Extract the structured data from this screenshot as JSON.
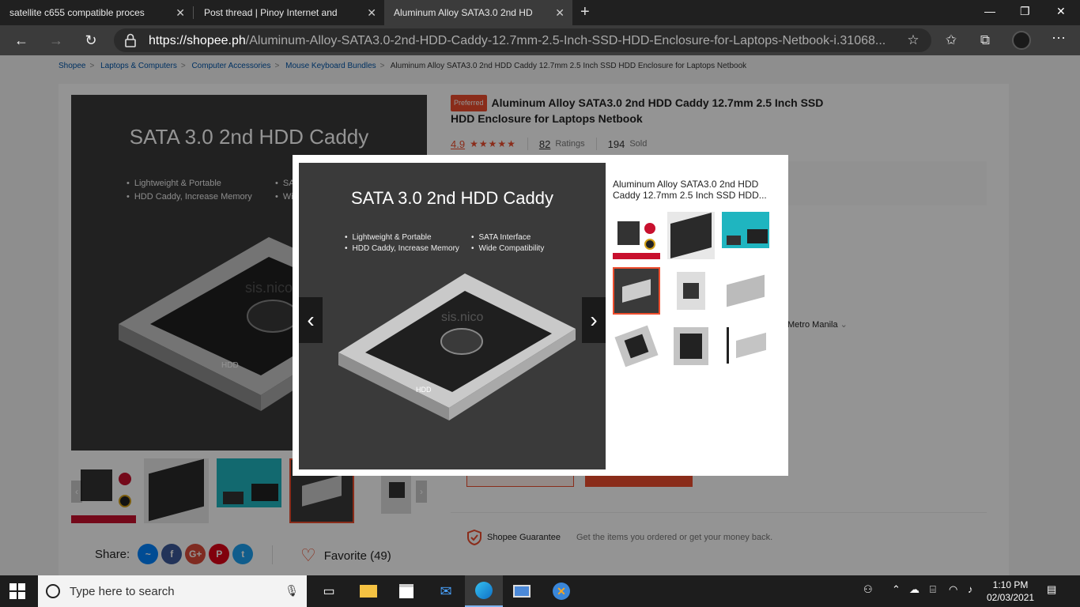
{
  "browser": {
    "tabs": [
      {
        "title": "satellite c655 compatible proces",
        "active": false
      },
      {
        "title": "Post thread | Pinoy Internet and",
        "active": false
      },
      {
        "title": "Aluminum Alloy SATA3.0 2nd HD",
        "active": true
      }
    ],
    "url_host": "https://shopee.ph",
    "url_path": "/Aluminum-Alloy-SATA3.0-2nd-HDD-Caddy-12.7mm-2.5-Inch-SSD-HDD-Enclosure-for-Laptops-Netbook-i.31068..."
  },
  "breadcrumb": [
    "Shopee",
    "Laptops & Computers",
    "Computer Accessories",
    "Mouse Keyboard Bundles",
    "Aluminum Alloy SATA3.0 2nd HDD Caddy 12.7mm 2.5 Inch SSD HDD Enclosure for Laptops Netbook"
  ],
  "product": {
    "badge": "Preferred",
    "title": "Aluminum Alloy SATA3.0 2nd HDD Caddy 12.7mm 2.5 Inch SSD HDD Enclosure for Laptops Netbook",
    "rating": "4.9",
    "stars": "★★★★★",
    "ratings_count": "82",
    "ratings_label": "Ratings",
    "sold_count": "194",
    "sold_label": "Sold",
    "location": "Metro Manila",
    "image_title": "SATA 3.0 2nd HDD Caddy",
    "features": [
      "Lightweight & Portable",
      "HDD Caddy, Increase Memory",
      "SATA Interface",
      "Wide Compatibility"
    ],
    "watermark": "sis.nico",
    "hdd_label": "HDD"
  },
  "guarantee": {
    "label": "Shopee Guarantee",
    "text": "Get the items you ordered or get your money back."
  },
  "share": {
    "label": "Share:",
    "favorite": "Favorite (49)"
  },
  "modal": {
    "title": "Aluminum Alloy SATA3.0 2nd HDD Caddy 12.7mm 2.5 Inch SSD HDD..."
  },
  "taskbar": {
    "search_placeholder": "Type here to search",
    "time": "1:10 PM",
    "date": "02/03/2021"
  },
  "colors": {
    "accent": "#ee4d2d",
    "browser_dark": "#202020"
  }
}
